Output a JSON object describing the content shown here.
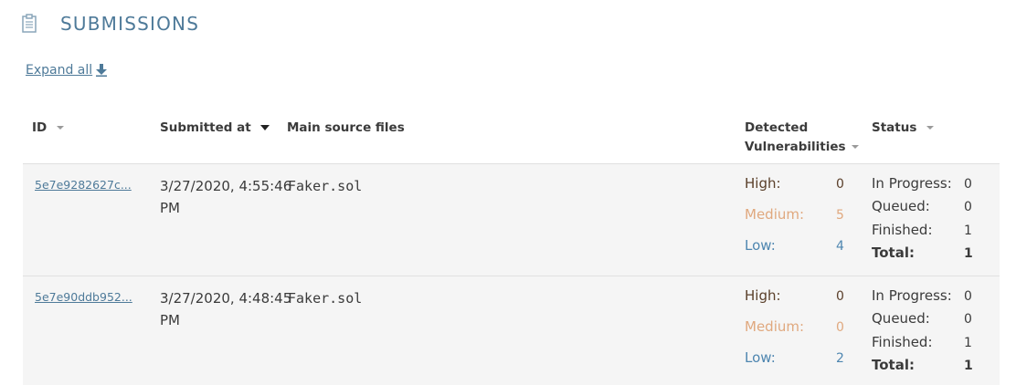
{
  "header": {
    "title": "SUBMISSIONS",
    "icon": "clipboard-icon"
  },
  "expand": {
    "label": "Expand all",
    "icon": "download-arrow-icon"
  },
  "columns": {
    "id": "ID",
    "submitted_at": "Submitted at",
    "main_source_files": "Main source files",
    "detected_line1": "Detected",
    "detected_line2": "Vulnerabilities",
    "status": "Status"
  },
  "labels": {
    "high": "High:",
    "medium": "Medium:",
    "low": "Low:",
    "in_progress": "In Progress:",
    "queued": "Queued:",
    "finished": "Finished:",
    "total": "Total:"
  },
  "colors": {
    "accent": "#4e7a99",
    "high": "#5a3f2a",
    "medium": "#e0a87e",
    "low": "#4e86b0",
    "row_bg": "#f5f5f5"
  },
  "rows": [
    {
      "id": "5e7e9282627c...",
      "submitted_date": "3/27/2020, 4:55:46",
      "submitted_ampm": "PM",
      "file": "Faker.sol",
      "high": "0",
      "medium": "5",
      "low": "4",
      "in_progress": "0",
      "queued": "0",
      "finished": "1",
      "total": "1"
    },
    {
      "id": "5e7e90ddb952...",
      "submitted_date": "3/27/2020, 4:48:45",
      "submitted_ampm": "PM",
      "file": "Faker.sol",
      "high": "0",
      "medium": "0",
      "low": "2",
      "in_progress": "0",
      "queued": "0",
      "finished": "1",
      "total": "1"
    }
  ]
}
